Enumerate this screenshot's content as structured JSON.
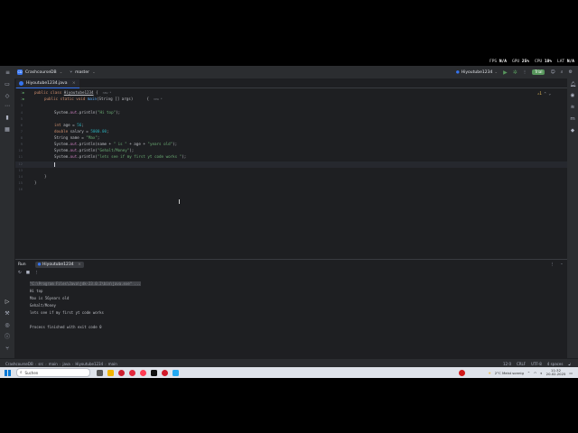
{
  "overlay": {
    "fps_label": "FPS",
    "fps_value": "N/A",
    "gpu_label": "GPU",
    "gpu_value": "25%",
    "cpu_label": "CPU",
    "cpu_value": "18%",
    "lat_label": "LAT",
    "lat_value": "N/A"
  },
  "titlebar": {
    "project_badge": "CD",
    "project": "CrashcourseDB",
    "branch": "master",
    "run_config": "Hiyoutube1234",
    "trial": "Trial"
  },
  "editor": {
    "tab_label": "Hiyoutube1234.java",
    "warnings": "⚠1",
    "lines": [
      {
        "n": "1"
      },
      {
        "n": "2"
      },
      {
        "n": "3"
      },
      {
        "n": "4"
      },
      {
        "n": "5"
      },
      {
        "n": "6"
      },
      {
        "n": "7"
      },
      {
        "n": "8"
      },
      {
        "n": "9"
      },
      {
        "n": "10"
      },
      {
        "n": "11"
      },
      {
        "n": "12"
      },
      {
        "n": "13"
      },
      {
        "n": "14"
      },
      {
        "n": "15"
      },
      {
        "n": "16"
      }
    ],
    "code": {
      "l1_kw": "public class ",
      "l1_name": "Hiyoutube1234",
      "l1_rest": " {",
      "l1_hint": "new *",
      "l2_kw": "public static void ",
      "l2_meth": "main",
      "l2_rest": "(String [] args)",
      "l2_brace": "{",
      "l2_hint": "new *",
      "l4_a": "System.",
      "l4_field": "out",
      "l4_b": ".println(",
      "l4_str": "\"Hi top\"",
      "l4_c": ");",
      "l6_kw": "int ",
      "l6_a": "age = ",
      "l6_num": "56",
      "l6_b": ";",
      "l7_kw": "double ",
      "l7_a": "salary = ",
      "l7_num": "5000.00",
      "l7_b": ";",
      "l8_a": "String name = ",
      "l8_str": "\"Max\"",
      "l8_b": ";",
      "l9_a": "System.",
      "l9_field": "out",
      "l9_b": ".println(name + ",
      "l9_s1": "\" is \"",
      "l9_c": " + age + ",
      "l9_s2": "\"years old\"",
      "l9_d": ");",
      "l10_a": "System.",
      "l10_field": "out",
      "l10_b": ".println(",
      "l10_str": "\"Gehalt/Money\"",
      "l10_c": ");",
      "l11_a": "System.",
      "l11_field": "out",
      "l11_b": ".println(",
      "l11_str": "\"lets see if my first yt code works \"",
      "l11_c": ");",
      "l14": "}",
      "l15": "}"
    }
  },
  "run": {
    "title": "Run",
    "tab": "Hiyoutube1234",
    "console": [
      "\"C:\\Program Files\\Java\\jdk-23.0.2\\bin\\java.exe\" ...",
      "Hi top",
      "Max is 56years old",
      "Gehalt/Money",
      "lets see if my first yt code works",
      "",
      "Process finished with exit code 0"
    ]
  },
  "statusbar": {
    "crumbs": [
      "CrashcourseDB",
      "src",
      "main",
      "java",
      "Hiyoutube1234",
      "main"
    ],
    "position": "12:0",
    "line_ending": "CRLF",
    "encoding": "UTF-8",
    "indent": "4 spaces"
  },
  "taskbar": {
    "search_placeholder": "Suchen",
    "weather": "2°C  Meist sonnig",
    "time": "11:32",
    "date": "20.02.2025"
  }
}
